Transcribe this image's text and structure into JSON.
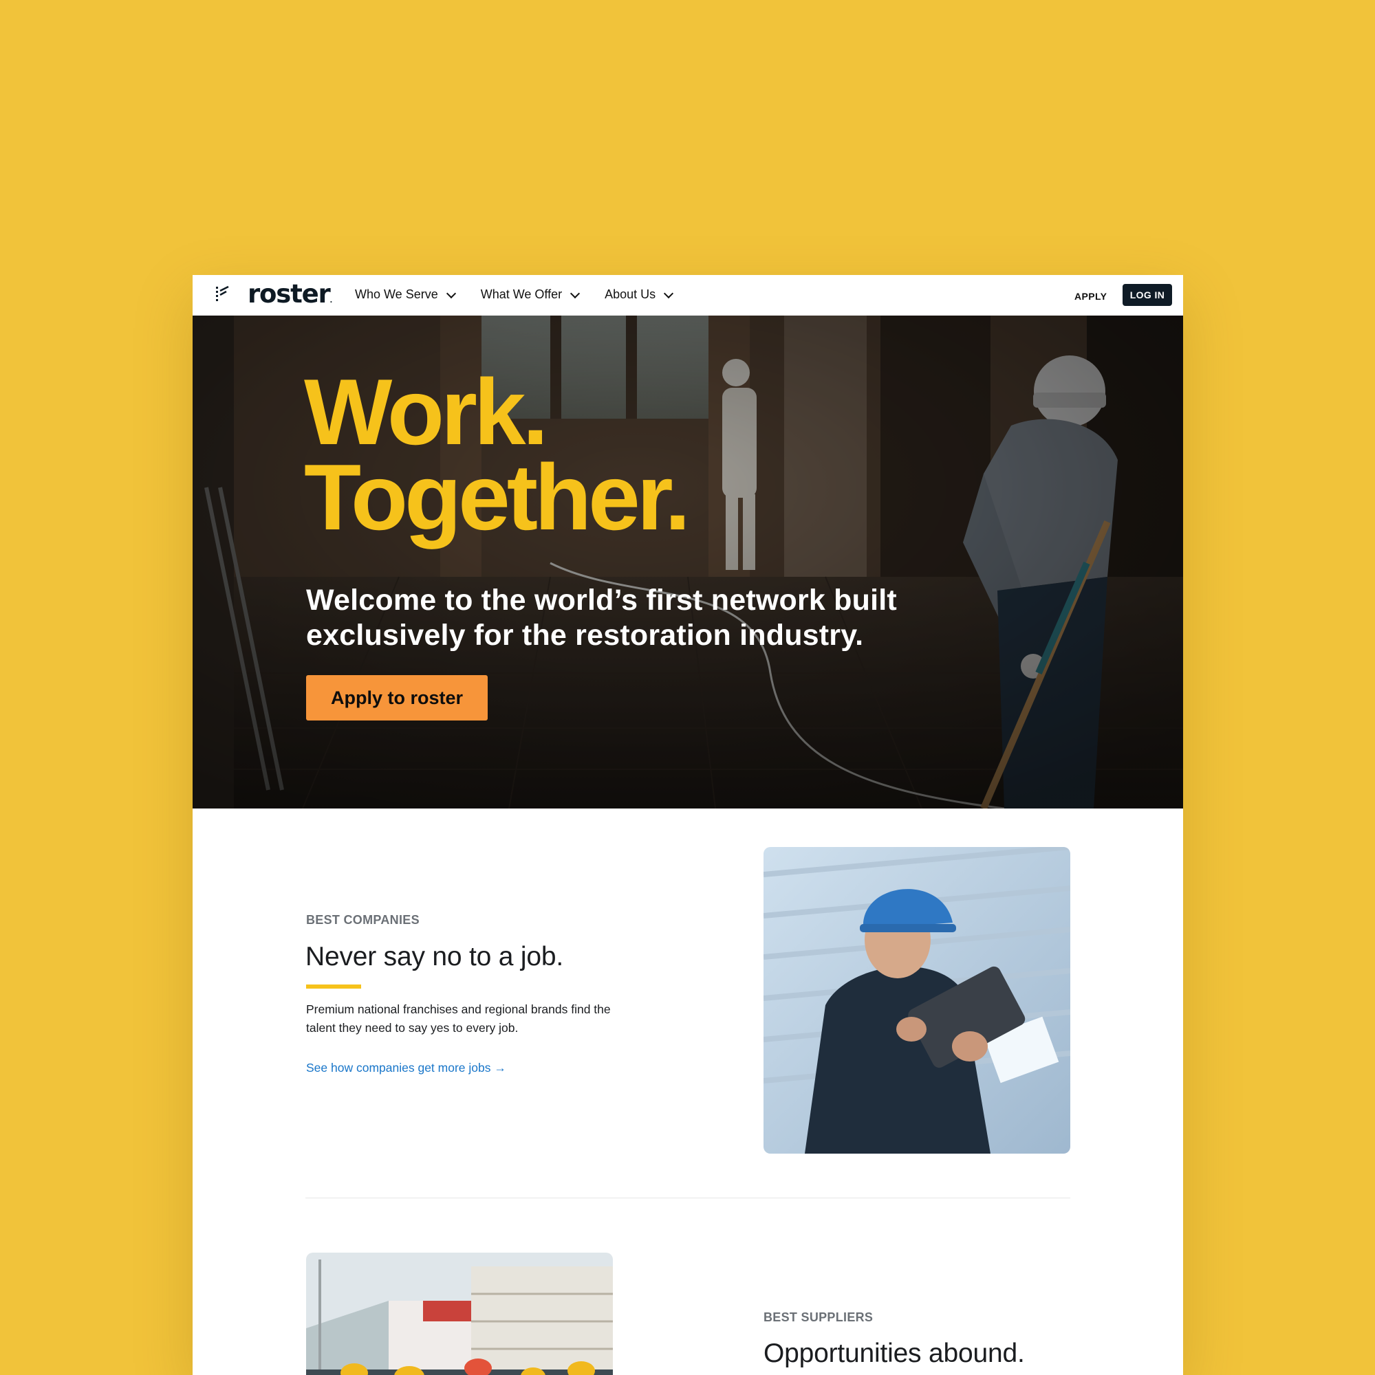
{
  "nav": {
    "logo_text": "roster",
    "menu": [
      {
        "label": "Who We Serve"
      },
      {
        "label": "What We Offer"
      },
      {
        "label": "About Us"
      }
    ],
    "apply_label": "APPLY",
    "login_label": "LOG IN"
  },
  "hero": {
    "title_line1": "Work.",
    "title_line2": "Together.",
    "subtitle": "Welcome to the world’s first network built exclusively for the restoration industry.",
    "cta_label": "Apply to roster"
  },
  "companies": {
    "eyebrow": "BEST COMPANIES",
    "title": "Never say no to a job.",
    "body": "Premium national franchises and regional brands find the talent they need to say yes to every job.",
    "link": "See how companies get more jobs →"
  },
  "suppliers": {
    "eyebrow": "BEST SUPPLIERS",
    "title": "Opportunities abound."
  },
  "colors": {
    "backdrop": "#F1C33A",
    "accent_yellow": "#F6C21B",
    "cta_orange": "#F7953A",
    "navy": "#0f1b26",
    "link_blue": "#1976c9"
  }
}
